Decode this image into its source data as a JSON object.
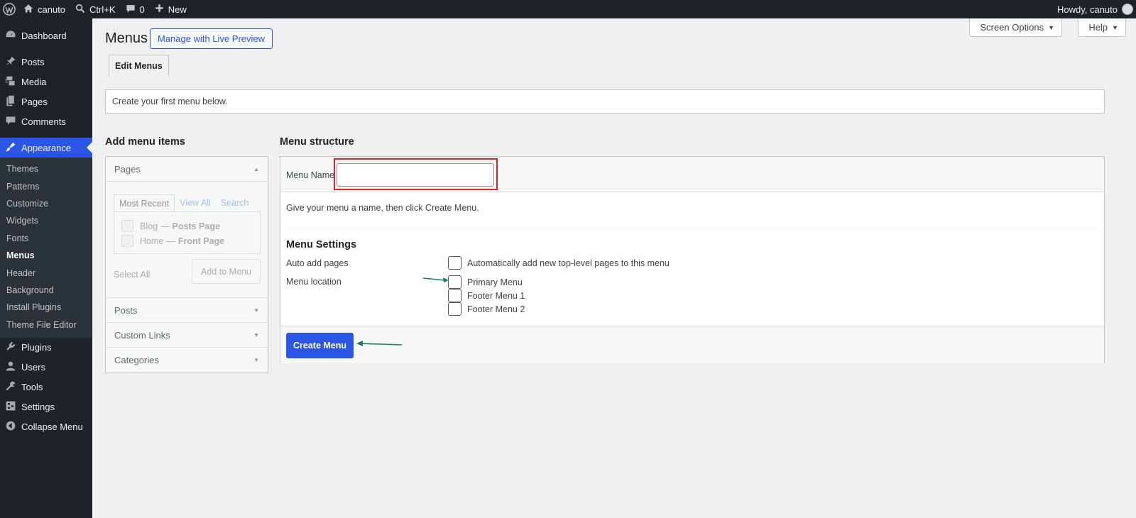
{
  "adminbar": {
    "site_name": "canuto",
    "search_shortcut": "Ctrl+K",
    "comments_count": "0",
    "new_label": "New",
    "howdy": "Howdy, canuto"
  },
  "sidebar": {
    "items": [
      {
        "label": "Dashboard",
        "icon": "dashboard-icon"
      },
      {
        "label": "Posts",
        "icon": "pin-icon"
      },
      {
        "label": "Media",
        "icon": "media-icon"
      },
      {
        "label": "Pages",
        "icon": "pages-icon"
      },
      {
        "label": "Comments",
        "icon": "comment-icon"
      },
      {
        "label": "Appearance",
        "icon": "brush-icon"
      },
      {
        "label": "Plugins",
        "icon": "plugin-icon"
      },
      {
        "label": "Users",
        "icon": "user-icon"
      },
      {
        "label": "Tools",
        "icon": "wrench-icon"
      },
      {
        "label": "Settings",
        "icon": "settings-icon"
      },
      {
        "label": "Collapse Menu",
        "icon": "collapse-icon"
      }
    ],
    "appearance_submenu": [
      "Themes",
      "Patterns",
      "Customize",
      "Widgets",
      "Fonts",
      "Menus",
      "Header",
      "Background",
      "Install Plugins",
      "Theme File Editor"
    ]
  },
  "header": {
    "screen_options": "Screen Options",
    "help": "Help",
    "title": "Menus",
    "live_preview": "Manage with Live Preview",
    "tab_edit": "Edit Menus",
    "notice": "Create your first menu below."
  },
  "left": {
    "heading": "Add menu items",
    "pages_label": "Pages",
    "tabs": [
      "Most Recent",
      "View All",
      "Search"
    ],
    "pages": [
      {
        "title": "Blog",
        "tag": "Posts Page"
      },
      {
        "title": "Home",
        "tag": "Front Page"
      }
    ],
    "select_all": "Select All",
    "add_to_menu": "Add to Menu",
    "sections": [
      "Posts",
      "Custom Links",
      "Categories"
    ]
  },
  "right": {
    "heading": "Menu structure",
    "menu_name_label": "Menu Name",
    "menu_name_value": "",
    "hint": "Give your menu a name, then click Create Menu.",
    "settings_title": "Menu Settings",
    "auto_add_label": "Auto add pages",
    "auto_add_option": "Automatically add new top-level pages to this menu",
    "location_label": "Menu location",
    "locations": [
      "Primary Menu",
      "Footer Menu 1",
      "Footer Menu 2"
    ],
    "create_button": "Create Menu"
  },
  "colors": {
    "accent": "#2b55e6",
    "highlight_border": "#e02424",
    "annotation_arrow": "#1a7f5a"
  }
}
